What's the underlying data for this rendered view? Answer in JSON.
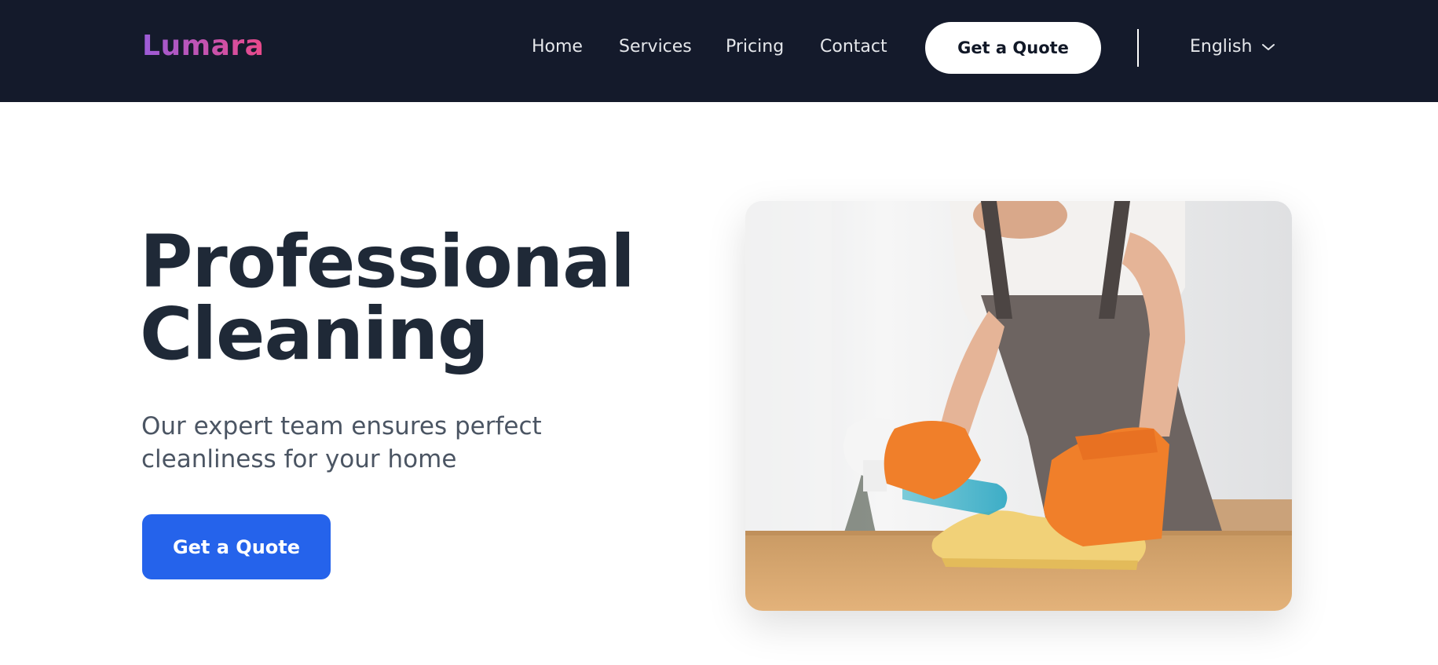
{
  "brand": {
    "name": "Lumara",
    "gradient_start": "#9b5cd8",
    "gradient_end": "#e94a8a"
  },
  "nav": {
    "links": [
      {
        "label": "Home"
      },
      {
        "label": "Services"
      },
      {
        "label": "Pricing"
      },
      {
        "label": "Contact"
      }
    ],
    "quote_label": "Get a Quote",
    "language": {
      "label": "English",
      "icon": "chevron-down-icon"
    }
  },
  "hero": {
    "title_line1": "Professional",
    "title_line2": "Cleaning",
    "subtitle": "Our expert team ensures perfect cleanliness for your home",
    "cta_label": "Get a Quote",
    "image_alt": "cleaning-photo"
  },
  "colors": {
    "navbar_bg": "#141a2b",
    "primary": "#2563eb",
    "heading": "#1f2937",
    "text_muted": "#4b5563"
  }
}
